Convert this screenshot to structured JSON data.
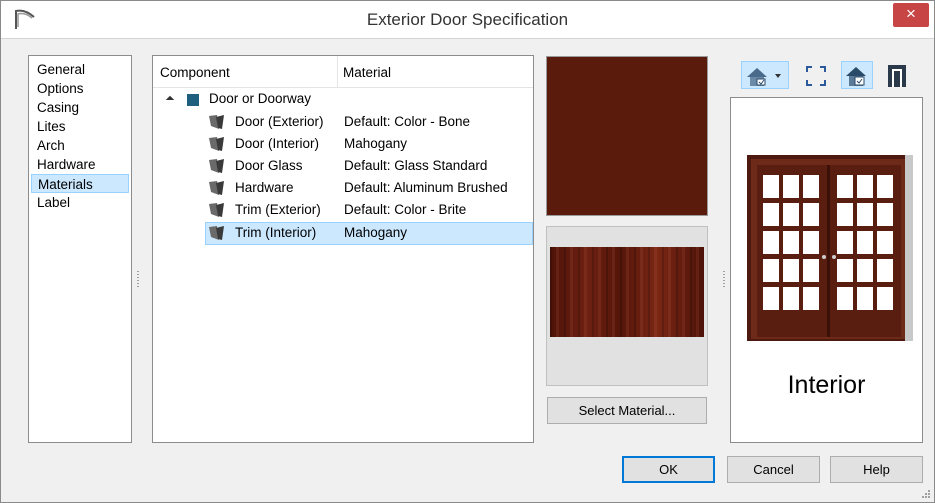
{
  "window": {
    "title": "Exterior Door Specification",
    "close_glyph": "×"
  },
  "nav": {
    "items": [
      {
        "label": "General"
      },
      {
        "label": "Options"
      },
      {
        "label": "Casing"
      },
      {
        "label": "Lites"
      },
      {
        "label": "Arch"
      },
      {
        "label": "Hardware"
      },
      {
        "label": "Materials",
        "selected": true
      },
      {
        "label": "Label"
      }
    ]
  },
  "components": {
    "headers": {
      "component": "Component",
      "material": "Material"
    },
    "root": {
      "label": "Door or Doorway",
      "icon": "square-material-icon"
    },
    "rows": [
      {
        "component": "Door (Exterior)",
        "material": "Default: Color - Bone"
      },
      {
        "component": "Door (Interior)",
        "material": "Mahogany"
      },
      {
        "component": "Door Glass",
        "material": "Default: Glass  Standard"
      },
      {
        "component": "Hardware",
        "material": "Default: Aluminum Brushed"
      },
      {
        "component": "Trim (Exterior)",
        "material": "Default: Color - Brite"
      },
      {
        "component": "Trim (Interior)",
        "material": "Mahogany",
        "selected": true
      }
    ]
  },
  "swatches": {
    "solid_color": "#5a1a0c"
  },
  "buttons": {
    "select_material": "Select Material...",
    "ok": "OK",
    "cancel": "Cancel",
    "help": "Help"
  },
  "preview": {
    "label": "Interior"
  },
  "toolbar": {
    "icons": [
      "view-mode-dropdown-icon",
      "fit-to-window-icon",
      "interior-view-icon",
      "elevation-view-icon"
    ]
  },
  "colors": {
    "accent": "#0078d7",
    "selection": "#cce8ff",
    "close": "#c74545",
    "wood": "#5a1a0c"
  }
}
